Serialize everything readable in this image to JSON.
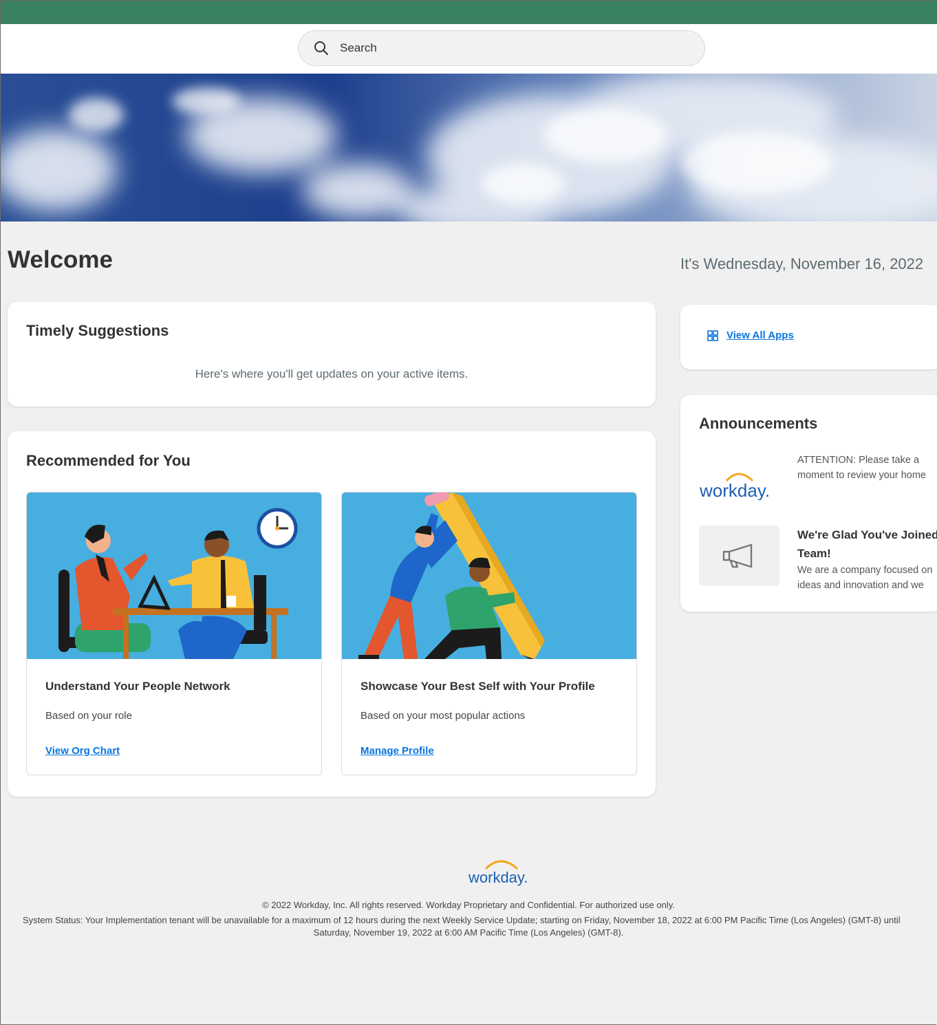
{
  "search": {
    "placeholder": "Search"
  },
  "welcome": {
    "title": "Welcome",
    "date": "It's Wednesday, November 16, 2022"
  },
  "timely": {
    "title": "Timely Suggestions",
    "description": "Here's where you'll get updates on your active items."
  },
  "recommended": {
    "title": "Recommended for You",
    "items": [
      {
        "title": "Understand Your People Network",
        "subtitle": "Based on your role",
        "link": "View Org Chart"
      },
      {
        "title": "Showcase Your Best Self with Your Profile",
        "subtitle": "Based on your most popular actions",
        "link": "Manage Profile"
      }
    ]
  },
  "apps": {
    "link": "View All Apps"
  },
  "announcements": {
    "title": "Announcements",
    "items": [
      {
        "logo_text": "workday.",
        "line1": "ATTENTION: Please take a",
        "line2": "moment to review your home"
      },
      {
        "title_line1": "We're Glad You've Joined",
        "title_line2": "Team!",
        "line1": "We are a company focused on",
        "line2": "ideas and innovation and we"
      }
    ]
  },
  "footer": {
    "logo_text": "workday.",
    "copyright": "© 2022 Workday, Inc. All rights reserved. Workday Proprietary and Confidential. For authorized use only.",
    "status_line1": "System Status: Your Implementation tenant will be unavailable for a maximum of 12 hours during the next Weekly Service Update; starting on Friday, November 18, 2022 at 6:00 PM Pacific Time (Los Angeles) (GMT-8) until",
    "status_line2": "Saturday, November 19, 2022 at 6:00 AM Pacific Time (Los Angeles) (GMT-8)."
  },
  "colors": {
    "topbar": "#3a8160",
    "link": "#0875e1",
    "brand_blue": "#1c5fb3",
    "brand_orange": "#f5a623",
    "background": "#f0f0f0"
  },
  "icons": [
    "search-icon",
    "grid-icon",
    "megaphone-icon"
  ]
}
